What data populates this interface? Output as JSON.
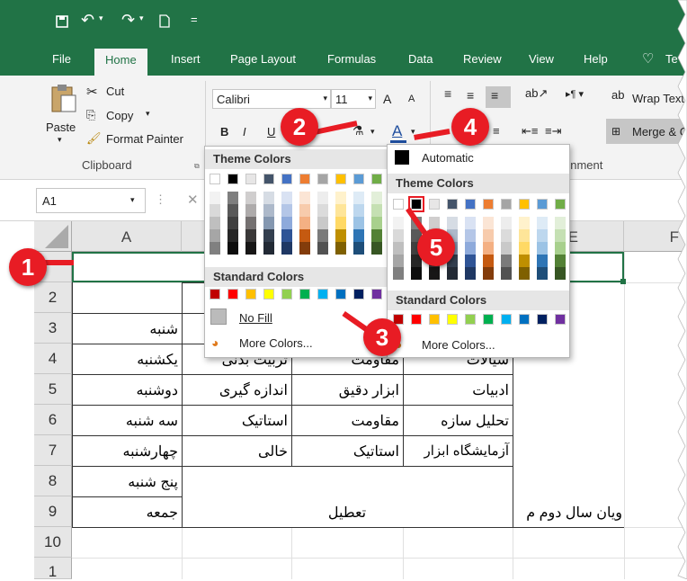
{
  "title_bar": {
    "save_icon": "save-icon",
    "undo_icon": "undo-icon",
    "redo_icon": "redo-icon",
    "new_icon": "new-document-icon",
    "customize": "="
  },
  "tabs": [
    "File",
    "Home",
    "Insert",
    "Page Layout",
    "Formulas",
    "Data",
    "Review",
    "View",
    "Help"
  ],
  "tell_me": "Te",
  "clipboard": {
    "paste": "Paste",
    "cut": "Cut",
    "copy": "Copy",
    "format_painter": "Format Painter",
    "group": "Clipboard"
  },
  "font": {
    "name": "Calibri",
    "size": "11",
    "bold": "B",
    "italic": "I",
    "grow": "A",
    "shrink": "A",
    "font_color_label": "A"
  },
  "alignment": {
    "wrap": "Wrap Text",
    "merge": "Merge & C",
    "group_partial": "gnment"
  },
  "name_box": "A1",
  "columns": [
    "A",
    "",
    "",
    "",
    "E",
    "F"
  ],
  "rows": [
    "",
    "2",
    "3",
    "4",
    "5",
    "6",
    "7",
    "8",
    "9",
    "10",
    "1"
  ],
  "cells": {
    "r3a": "شنبه",
    "r4a": "یکشنبه",
    "r4b": "تربیت بدنی",
    "r4c": "مقاومت",
    "r4d": "سیالات",
    "r5a": "دوشنبه",
    "r5b": "اندازه گیری",
    "r5c": "ابزار دقیق",
    "r5d": "ادبیات",
    "r6a": "سه شنبه",
    "r6b": "استاتیک",
    "r6c": "مقاومت",
    "r6d": "تحلیل سازه",
    "r7a": "چهارشنبه",
    "r7b": "خالی",
    "r7c": "استاتیک",
    "r7d": "آزمایشگاه ابزار",
    "r8a": "پنج شنبه",
    "r9a": "جمعه",
    "r89": "تعطیل",
    "r9e": "ویان سال دوم م"
  },
  "fill_dropdown": {
    "theme_title": "Theme Colors",
    "standard_title": "Standard Colors",
    "no_fill": "No Fill",
    "more": "More Colors..."
  },
  "font_dropdown": {
    "automatic": "Automatic",
    "theme_title": "Theme Colors",
    "standard_title": "Standard Colors",
    "more": "More Colors..."
  },
  "theme_top": [
    "#ffffff",
    "#000000",
    "#e7e6e6",
    "#44546a",
    "#4472c4",
    "#ed7d31",
    "#a5a5a5",
    "#ffc000",
    "#5b9bd5",
    "#70ad47"
  ],
  "theme_shades": [
    [
      "#f2f2f2",
      "#d9d9d9",
      "#bfbfbf",
      "#a6a6a6",
      "#808080"
    ],
    [
      "#7f7f7f",
      "#595959",
      "#404040",
      "#262626",
      "#0d0d0d"
    ],
    [
      "#d0cece",
      "#aeabab",
      "#757171",
      "#3a3838",
      "#171616"
    ],
    [
      "#d6dce4",
      "#adb9ca",
      "#8497b0",
      "#333f4f",
      "#222a35"
    ],
    [
      "#d9e2f3",
      "#b4c6e7",
      "#8eaadb",
      "#2f5496",
      "#1f3864"
    ],
    [
      "#fbe5d5",
      "#f7cbac",
      "#f4b083",
      "#c55a11",
      "#833c0b"
    ],
    [
      "#ededed",
      "#dbdbdb",
      "#c9c9c9",
      "#7b7b7b",
      "#525252"
    ],
    [
      "#fff2cc",
      "#fee599",
      "#ffd965",
      "#bf8f00",
      "#7f6000"
    ],
    [
      "#deebf6",
      "#bdd7ee",
      "#9cc3e5",
      "#2e75b5",
      "#1e4e79"
    ],
    [
      "#e2efd9",
      "#c5e0b3",
      "#a8d08d",
      "#538135",
      "#375623"
    ]
  ],
  "standard": [
    "#c00000",
    "#ff0000",
    "#ffc000",
    "#ffff00",
    "#92d050",
    "#00b050",
    "#00b0f0",
    "#0070c0",
    "#002060",
    "#7030a0"
  ],
  "callouts": [
    "1",
    "2",
    "3",
    "4",
    "5"
  ]
}
